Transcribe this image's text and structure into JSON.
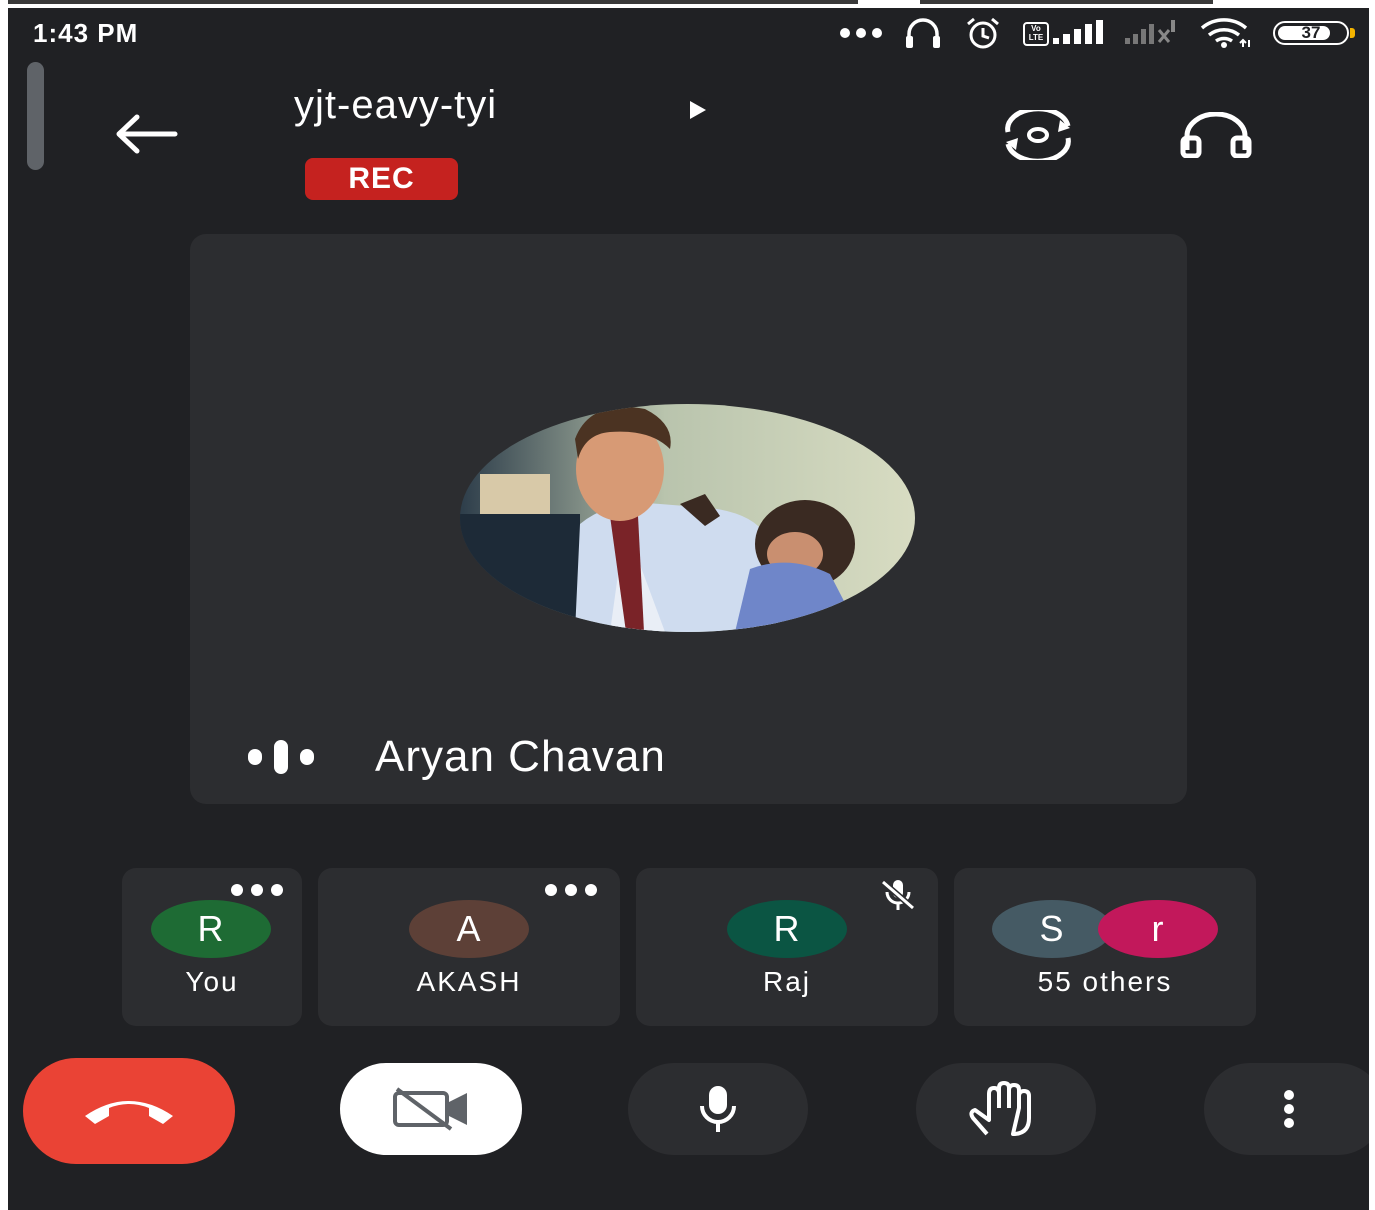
{
  "status_bar": {
    "time": "1:43 PM",
    "icons": [
      "more-dots-icon",
      "headset-icon",
      "alarm-icon",
      "volte-icon",
      "signal-icon",
      "signal-no-service-icon",
      "wifi-icon",
      "battery-icon"
    ],
    "volte_label": "Vo LTE",
    "battery_level": "37"
  },
  "header": {
    "back_icon": "arrow-left-icon",
    "meeting_code": "yjt-eavy-tyi",
    "expand_icon": "play-arrow-icon",
    "recording_badge": "REC",
    "switch_camera_icon": "switch-camera-icon",
    "audio_output_icon": "headphones-icon"
  },
  "main_speaker": {
    "name": "Aryan Chavan",
    "speaking_indicator": "audio-level-icon"
  },
  "participants": [
    {
      "initial": "R",
      "name": "You",
      "avatar_color": "#1e6b34",
      "has_menu": true
    },
    {
      "initial": "A",
      "name": "AKASH",
      "avatar_color": "#5d4037",
      "has_menu": true
    },
    {
      "initial": "R",
      "name": "Raj",
      "avatar_color": "#0b5543",
      "muted": true
    }
  ],
  "others": {
    "label": "55 others",
    "avatars": [
      {
        "initial": "S",
        "color": "#455a64"
      },
      {
        "initial": "r",
        "color": "#c2185b"
      }
    ]
  },
  "controls": {
    "end_call_icon": "call-end-icon",
    "video_icon": "videocam-off-icon",
    "mic_icon": "mic-icon",
    "raise_hand_icon": "hand-icon",
    "more_icon": "more-vert-icon"
  },
  "colors": {
    "background": "#202124",
    "tile": "#2c2d30",
    "rec": "#c5221f",
    "end_call": "#ea4335"
  }
}
